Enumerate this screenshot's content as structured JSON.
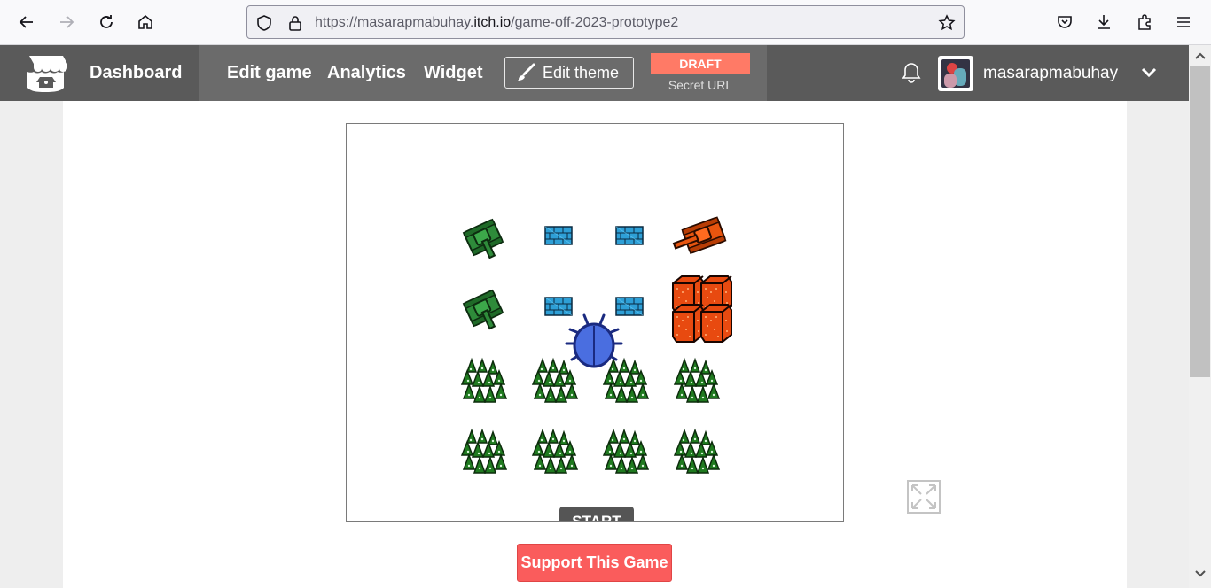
{
  "browser": {
    "url_prefix": "https://masarapmabuhay.",
    "url_host": "itch.io",
    "url_path": "/game-off-2023-prototype2"
  },
  "header": {
    "dashboard": "Dashboard",
    "edit_game": "Edit game",
    "analytics": "Analytics",
    "widget": "Widget",
    "edit_theme": "Edit theme",
    "draft": "DRAFT",
    "secret_url": "Secret URL",
    "username": "masarapmabuhay"
  },
  "game": {
    "start_label": "START"
  },
  "support_label": "Support This Game",
  "colors": {
    "header_bg": "#5a5a5a",
    "edit_panel_bg": "#6b6b6b",
    "draft_badge": "#ff7a66",
    "support_button": "#fa5c5c"
  }
}
